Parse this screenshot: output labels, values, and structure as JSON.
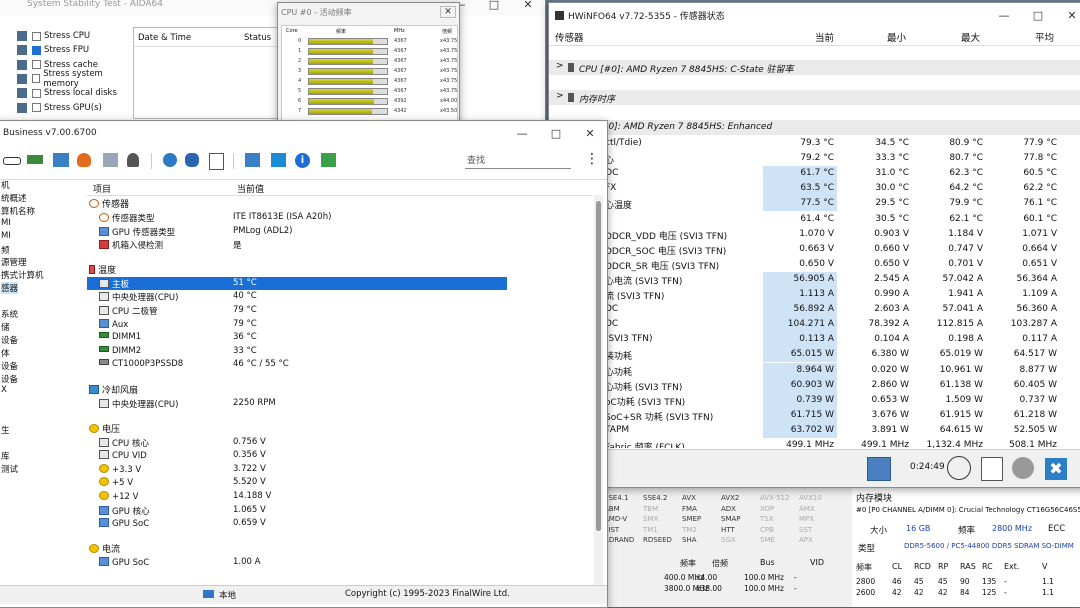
{
  "stability": {
    "title": "System Stability Test - AIDA64",
    "items": [
      {
        "label": "Stress CPU",
        "checked": false
      },
      {
        "label": "Stress FPU",
        "checked": true
      },
      {
        "label": "Stress cache",
        "checked": false
      },
      {
        "label": "Stress system memory",
        "checked": false
      },
      {
        "label": "Stress local disks",
        "checked": false
      },
      {
        "label": "Stress GPU(s)",
        "checked": false
      }
    ],
    "col_date": "Date & Time",
    "col_status": "Status"
  },
  "cpufreq": {
    "title": "CPU #0 - 活动频率",
    "headers": [
      "Core",
      "频率",
      "MHz",
      "倍频"
    ],
    "rows": [
      {
        "core": "0",
        "mhz": "4367",
        "mult": "x43.75",
        "fill": 0.82
      },
      {
        "core": "1",
        "mhz": "4367",
        "mult": "x43.75",
        "fill": 0.82
      },
      {
        "core": "2",
        "mhz": "4367",
        "mult": "x43.75",
        "fill": 0.82
      },
      {
        "core": "3",
        "mhz": "4367",
        "mult": "x43.75",
        "fill": 0.82
      },
      {
        "core": "4",
        "mhz": "4367",
        "mult": "x43.75",
        "fill": 0.82
      },
      {
        "core": "5",
        "mhz": "4367",
        "mult": "x43.75",
        "fill": 0.82
      },
      {
        "core": "6",
        "mhz": "4392",
        "mult": "x44.00",
        "fill": 0.83
      },
      {
        "core": "7",
        "mhz": "4342",
        "mult": "x43.50",
        "fill": 0.81
      }
    ]
  },
  "aida": {
    "title": "Business v7.00.6700",
    "search_placeholder": "查找",
    "col_item": "项目",
    "col_value": "当前值",
    "tree": [
      "机",
      "统概述",
      "算机名称",
      "MI",
      "MI",
      "频",
      "源管理",
      "携式计算机",
      "感器",
      "",
      "系统",
      "储",
      "设备",
      "体",
      "设备",
      "设备",
      "X",
      "",
      "",
      "生",
      "",
      "库",
      "测试"
    ],
    "rows": [
      {
        "type": "sect",
        "label": "传感器",
        "icon": "circ"
      },
      {
        "label": "传感器类型",
        "value": "ITE IT8613E  (ISA A20h)",
        "icon": "circ"
      },
      {
        "label": "GPU 传感器类型",
        "value": "PMLog  (ADL2)",
        "icon": "mon"
      },
      {
        "label": "机箱入侵检测",
        "value": "是",
        "icon": "shield"
      },
      {
        "type": "gap"
      },
      {
        "type": "sect",
        "label": "温度",
        "icon": "therm"
      },
      {
        "label": "主板",
        "value": "51 °C",
        "icon": "box",
        "selected": true
      },
      {
        "label": "中央处理器(CPU)",
        "value": "40 °C",
        "icon": "box"
      },
      {
        "label": "CPU 二极管",
        "value": "79 °C",
        "icon": "box"
      },
      {
        "label": "Aux",
        "value": "79 °C",
        "icon": "mon"
      },
      {
        "label": "DIMM1",
        "value": "36 °C",
        "icon": "ram"
      },
      {
        "label": "DIMM2",
        "value": "33 °C",
        "icon": "ram"
      },
      {
        "label": "CT1000P3PSSD8",
        "value": "46 °C / 55 °C",
        "icon": "disk"
      },
      {
        "type": "gap"
      },
      {
        "type": "sect",
        "label": "冷却风扇",
        "icon": "fan"
      },
      {
        "label": "中央处理器(CPU)",
        "value": "2250 RPM",
        "icon": "box"
      },
      {
        "type": "gap"
      },
      {
        "type": "sect",
        "label": "电压",
        "icon": "bolt"
      },
      {
        "label": "CPU 核心",
        "value": "0.756 V",
        "icon": "box"
      },
      {
        "label": "CPU VID",
        "value": "0.356 V",
        "icon": "box"
      },
      {
        "label": "+3.3 V",
        "value": "3.722 V",
        "icon": "bolt"
      },
      {
        "label": "+5 V",
        "value": "5.520 V",
        "icon": "bolt"
      },
      {
        "label": "+12 V",
        "value": "14.188 V",
        "icon": "bolt"
      },
      {
        "label": "GPU 核心",
        "value": "1.065 V",
        "icon": "mon"
      },
      {
        "label": "GPU SoC",
        "value": "0.659 V",
        "icon": "mon"
      },
      {
        "type": "gap"
      },
      {
        "type": "sect",
        "label": "电流",
        "icon": "bolt"
      },
      {
        "label": "GPU SoC",
        "value": "1.00 A",
        "icon": "mon"
      }
    ],
    "status_left": "本地",
    "status_right": "Copyright (c) 1995-2023 FinalWire Ltd."
  },
  "hwinfo": {
    "title": "HWiNFO64 v7.72-5355 - 传感器状态",
    "headers": [
      "传感器",
      "当前",
      "最小",
      "最大",
      "平均"
    ],
    "groups": [
      "CPU [#0]: AMD Ryzen 7 8845HS: C-State 驻留率",
      "内存时序",
      "#0]: AMD Ryzen 7 8845HS: Enhanced"
    ],
    "rows": [
      {
        "name": "ctl/Tdie)",
        "cur": "79.3 °C",
        "min": "34.5 °C",
        "max": "80.9 °C",
        "avg": "77.9 °C",
        "hl": false
      },
      {
        "name": "心",
        "cur": "79.2 °C",
        "min": "33.3 °C",
        "max": "80.7 °C",
        "avg": "77.8 °C",
        "hl": false
      },
      {
        "name": "OC",
        "cur": "61.7 °C",
        "min": "31.0 °C",
        "max": "62.3 °C",
        "avg": "60.5 °C",
        "hl": true
      },
      {
        "name": "FX",
        "cur": "63.5 °C",
        "min": "30.0 °C",
        "max": "64.2 °C",
        "avg": "62.2 °C",
        "hl": true
      },
      {
        "name": "心温度",
        "cur": "77.5 °C",
        "min": "29.5 °C",
        "max": "79.9 °C",
        "avg": "76.1 °C",
        "hl": true
      },
      {
        "name": "",
        "cur": "61.4 °C",
        "min": "30.5 °C",
        "max": "62.1 °C",
        "avg": "60.1 °C",
        "hl": false
      },
      {
        "name": "DDCR_VDD 电压 (SVI3 TFN)",
        "cur": "1.070 V",
        "min": "0.903 V",
        "max": "1.184 V",
        "avg": "1.071 V",
        "hl": false
      },
      {
        "name": "DDCR_SOC 电压 (SVI3 TFN)",
        "cur": "0.663 V",
        "min": "0.660 V",
        "max": "0.747 V",
        "avg": "0.664 V",
        "hl": false
      },
      {
        "name": "DDCR_SR 电压 (SVI3 TFN)",
        "cur": "0.650 V",
        "min": "0.650 V",
        "max": "0.701 V",
        "avg": "0.651 V",
        "hl": false
      },
      {
        "name": "心电流 (SVI3 TFN)",
        "cur": "56.905 A",
        "min": "2.545 A",
        "max": "57.042 A",
        "avg": "56.364 A",
        "hl": true
      },
      {
        "name": "流 (SVI3 TFN)",
        "cur": "1.113 A",
        "min": "0.990 A",
        "max": "1.941 A",
        "avg": "1.109 A",
        "hl": true
      },
      {
        "name": "DC",
        "cur": "56.892 A",
        "min": "2.603 A",
        "max": "57.041 A",
        "avg": "56.360 A",
        "hl": true
      },
      {
        "name": "DC",
        "cur": "104.271 A",
        "min": "78.392 A",
        "max": "112.815 A",
        "avg": "103.287 A",
        "hl": true
      },
      {
        "name": "(SVI3 TFN)",
        "cur": "0.113 A",
        "min": "0.104 A",
        "max": "0.198 A",
        "avg": "0.117 A",
        "hl": true
      },
      {
        "name": "装功耗",
        "cur": "65.015 W",
        "min": "6.380 W",
        "max": "65.019 W",
        "avg": "64.517 W",
        "hl": true
      },
      {
        "name": "心功耗",
        "cur": "8.964 W",
        "min": "0.020 W",
        "max": "10.961 W",
        "avg": "8.877 W",
        "hl": true
      },
      {
        "name": "心功耗 (SVI3 TFN)",
        "cur": "60.903 W",
        "min": "2.860 W",
        "max": "61.138 W",
        "avg": "60.405 W",
        "hl": true
      },
      {
        "name": "oC功耗 (SVI3 TFN)",
        "cur": "0.739 W",
        "min": "0.653 W",
        "max": "1.509 W",
        "avg": "0.737 W",
        "hl": true
      },
      {
        "name": "SoC+SR 功耗 (SVI3 TFN)",
        "cur": "61.715 W",
        "min": "3.676 W",
        "max": "61.915 W",
        "avg": "61.218 W",
        "hl": true
      },
      {
        "name": "TAPM",
        "cur": "63.702 W",
        "min": "3.891 W",
        "max": "64.615 W",
        "avg": "52.505 W",
        "hl": true
      },
      {
        "name": "Fabric 频率 (FCLK)",
        "cur": "499.1 MHz",
        "min": "499.1 MHz",
        "max": "1,132.4 MHz",
        "avg": "508.1 MHz",
        "hl": false
      }
    ],
    "timer": "0:24:49"
  },
  "cpuz": {
    "features": [
      [
        "SSE4.1",
        "SSE4.2",
        "AVX",
        "AVX2",
        "AVX-512",
        "AVX10"
      ],
      [
        "ABM",
        "TBM",
        "FMA",
        "ADX",
        "XOP",
        "AMX"
      ],
      [
        "AMD-V",
        "SMX",
        "SMEP",
        "SMAP",
        "TSX",
        "MPX"
      ],
      [
        "EIST",
        "TM1",
        "TM2",
        "HTT",
        "CPB",
        "SST"
      ],
      [
        "RDRAND",
        "RDSEED",
        "SHA",
        "SGX",
        "SME",
        "APX"
      ]
    ],
    "freq_headers": [
      "频率",
      "倍频",
      "Bus",
      "VID"
    ],
    "freq_rows": [
      [
        "400.0 MHz",
        "x4.00",
        "100.0 MHz",
        "-"
      ],
      [
        "3800.0 MHz",
        "x38.00",
        "100.0 MHz",
        "-"
      ]
    ],
    "mem_title": "内存模块",
    "mem_slot": "#0 [P0 CHANNEL A/DIMM 0]: Crucial Technology CT16G56C46S5",
    "size_label": "大小",
    "size_value": "16 GB",
    "freq_label": "频率",
    "freq_value": "2800 MHz",
    "ecc_label": "ECC",
    "type_label": "类型",
    "type_value": "DDR5-5600 / PC5-44800 DDR5 SDRAM SO-DIMM",
    "timing_headers": [
      "频率",
      "CL",
      "RCD",
      "RP",
      "RAS",
      "RC",
      "Ext.",
      "V"
    ],
    "timing_rows": [
      [
        "2800",
        "46",
        "45",
        "45",
        "90",
        "135",
        "-",
        "1.1"
      ],
      [
        "2600",
        "42",
        "42",
        "42",
        "84",
        "125",
        "-",
        "1.1"
      ]
    ]
  }
}
